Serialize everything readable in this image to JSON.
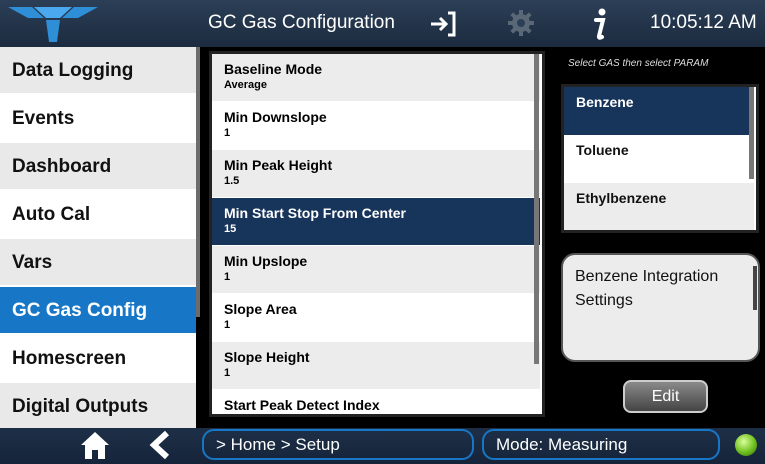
{
  "header": {
    "title": "GC Gas Configuration",
    "time": "10:05:12 AM",
    "icons": [
      "logo-icon",
      "exit-icon",
      "gear-icon",
      "info-icon"
    ]
  },
  "sidebar": {
    "items": [
      {
        "label": "Data Logging"
      },
      {
        "label": "Events"
      },
      {
        "label": "Dashboard"
      },
      {
        "label": "Auto Cal"
      },
      {
        "label": "Vars"
      },
      {
        "label": "GC Gas Config",
        "active": true
      },
      {
        "label": "Homescreen"
      },
      {
        "label": "Digital Outputs"
      }
    ]
  },
  "params": {
    "items": [
      {
        "name": "Baseline Mode",
        "value": "Average"
      },
      {
        "name": "Min Downslope",
        "value": "1"
      },
      {
        "name": "Min Peak Height",
        "value": "1.5"
      },
      {
        "name": "Min Start Stop From Center",
        "value": "15",
        "active": true
      },
      {
        "name": "Min Upslope",
        "value": "1"
      },
      {
        "name": "Slope Area",
        "value": "1"
      },
      {
        "name": "Slope Height",
        "value": "1"
      },
      {
        "name": "Start Peak Detect Index",
        "value": ""
      }
    ]
  },
  "gas": {
    "hint": "Select GAS then select PARAM",
    "items": [
      {
        "name": "Benzene",
        "active": true
      },
      {
        "name": "Toluene"
      },
      {
        "name": "Ethylbenzene"
      }
    ]
  },
  "settings_box": {
    "label": "Benzene Integration Settings"
  },
  "buttons": {
    "edit": "Edit"
  },
  "footer": {
    "breadcrumb": "> Home > Setup",
    "mode": "Mode: Measuring"
  },
  "colors": {
    "accent": "#1777c6",
    "selected": "#17345a",
    "header": "#23354c",
    "status_ok": "#6fbf1f"
  }
}
